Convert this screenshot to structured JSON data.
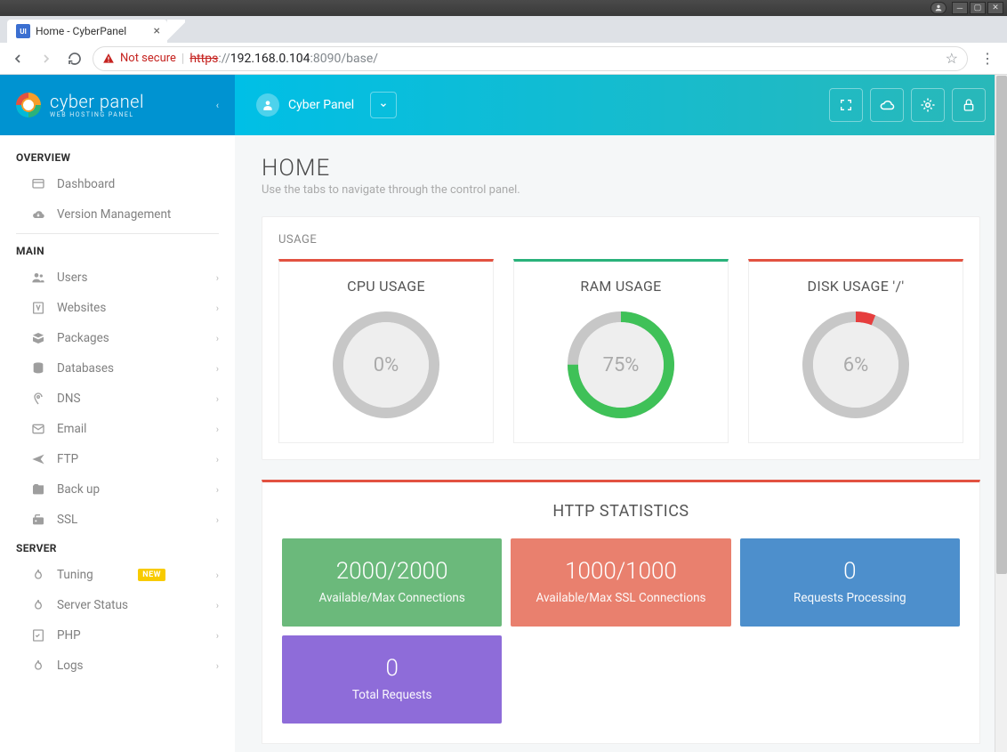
{
  "os": {
    "minimize": "_",
    "maximize": "□",
    "close": "×"
  },
  "browser": {
    "tab_title": "Home - CyberPanel",
    "favicon_text": "UI",
    "not_secure": "Not secure",
    "https": "https",
    "sep": "://",
    "host": "192.168.0.104",
    "port": ":8090",
    "path": "/base/"
  },
  "brand": {
    "name": "cyber panel",
    "sub": "WEB HOSTING PANEL"
  },
  "user": {
    "name": "Cyber Panel"
  },
  "sections": {
    "overview": "OVERVIEW",
    "main": "MAIN",
    "server": "SERVER"
  },
  "nav": {
    "overview": [
      {
        "label": "Dashboard",
        "icon": "dashboard"
      },
      {
        "label": "Version Management",
        "icon": "cloud"
      }
    ],
    "main": [
      {
        "label": "Users",
        "icon": "users"
      },
      {
        "label": "Websites",
        "icon": "websites"
      },
      {
        "label": "Packages",
        "icon": "packages"
      },
      {
        "label": "Databases",
        "icon": "database"
      },
      {
        "label": "DNS",
        "icon": "dns"
      },
      {
        "label": "Email",
        "icon": "email"
      },
      {
        "label": "FTP",
        "icon": "ftp"
      },
      {
        "label": "Back up",
        "icon": "backup"
      },
      {
        "label": "SSL",
        "icon": "ssl"
      }
    ],
    "server": [
      {
        "label": "Tuning",
        "icon": "flame",
        "badge": "NEW"
      },
      {
        "label": "Server Status",
        "icon": "flame"
      },
      {
        "label": "PHP",
        "icon": "php"
      },
      {
        "label": "Logs",
        "icon": "flame"
      }
    ]
  },
  "page": {
    "title": "HOME",
    "subtitle": "Use the tabs to navigate through the control panel."
  },
  "usage": {
    "title": "USAGE",
    "cards": [
      {
        "title": "CPU USAGE",
        "value": 0,
        "display": "0%",
        "color": "#c7c7c7"
      },
      {
        "title": "RAM USAGE",
        "value": 75,
        "display": "75%",
        "color": "#3fc158"
      },
      {
        "title": "DISK USAGE '/'",
        "value": 6,
        "display": "6%",
        "color": "#e63e3e"
      }
    ]
  },
  "http_stats": {
    "title": "HTTP STATISTICS",
    "boxes": [
      {
        "num": "2000/2000",
        "label": "Available/Max Connections",
        "cls": "sb-green"
      },
      {
        "num": "1000/1000",
        "label": "Available/Max SSL Connections",
        "cls": "sb-orange"
      },
      {
        "num": "0",
        "label": "Requests Processing",
        "cls": "sb-blue"
      },
      {
        "num": "0",
        "label": "Total Requests",
        "cls": "sb-purple"
      }
    ]
  }
}
